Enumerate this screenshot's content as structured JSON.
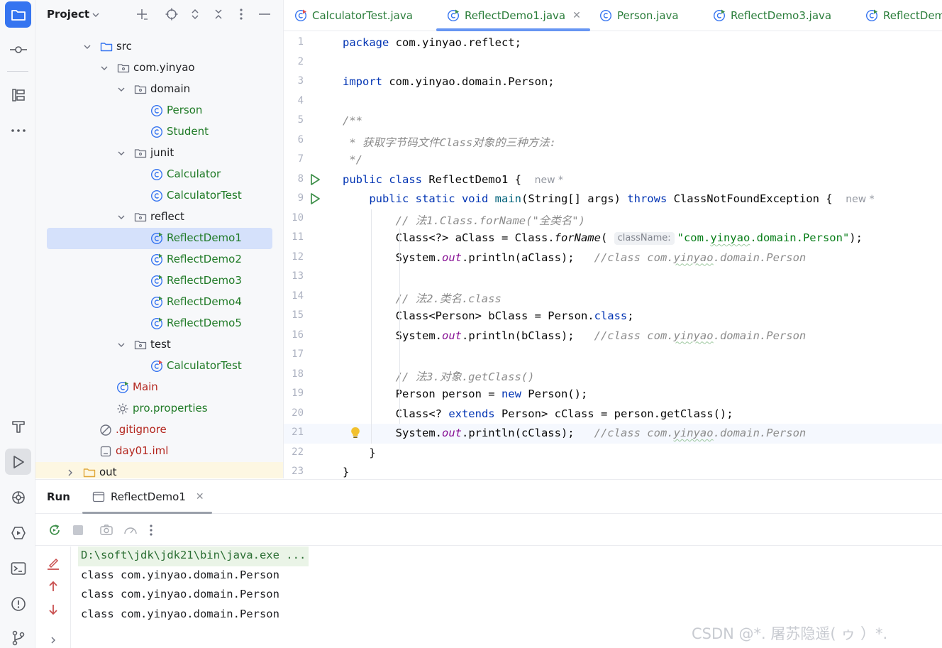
{
  "project_panel": {
    "title": "Project",
    "tree": [
      {
        "label": "src",
        "kind": "folder",
        "depth": 0,
        "expanded": true
      },
      {
        "label": "com.yinyao",
        "kind": "package",
        "depth": 1,
        "expanded": true
      },
      {
        "label": "domain",
        "kind": "package",
        "depth": 2,
        "expanded": true
      },
      {
        "label": "Person",
        "kind": "class",
        "depth": 3
      },
      {
        "label": "Student",
        "kind": "class",
        "depth": 3
      },
      {
        "label": "junit",
        "kind": "package",
        "depth": 2,
        "expanded": true
      },
      {
        "label": "Calculator",
        "kind": "class",
        "depth": 3
      },
      {
        "label": "CalculatorTest",
        "kind": "class",
        "depth": 3
      },
      {
        "label": "reflect",
        "kind": "package",
        "depth": 2,
        "expanded": true
      },
      {
        "label": "ReflectDemo1",
        "kind": "main-class",
        "depth": 3,
        "selected": true
      },
      {
        "label": "ReflectDemo2",
        "kind": "main-class",
        "depth": 3
      },
      {
        "label": "ReflectDemo3",
        "kind": "main-class",
        "depth": 3
      },
      {
        "label": "ReflectDemo4",
        "kind": "main-class",
        "depth": 3
      },
      {
        "label": "ReflectDemo5",
        "kind": "main-class",
        "depth": 3
      },
      {
        "label": "test",
        "kind": "package",
        "depth": 2,
        "expanded": true
      },
      {
        "label": "CalculatorTest",
        "kind": "test-class",
        "depth": 3
      },
      {
        "label": "Main",
        "kind": "main-class-red",
        "depth": 1
      },
      {
        "label": "pro.properties",
        "kind": "properties",
        "depth": 1
      },
      {
        "label": ".gitignore",
        "kind": "ignore",
        "depth": 0
      },
      {
        "label": "day01.iml",
        "kind": "iml",
        "depth": 0
      },
      {
        "label": "out",
        "kind": "out-folder",
        "depth": -1
      }
    ]
  },
  "tabs": [
    {
      "label": "CalculatorTest.java",
      "active": false
    },
    {
      "label": "ReflectDemo1.java",
      "active": true
    },
    {
      "label": "Person.java",
      "active": false
    },
    {
      "label": "ReflectDemo3.java",
      "active": false
    },
    {
      "label": "ReflectDem",
      "active": false
    }
  ],
  "editor": {
    "current_line": 21,
    "lines": [
      {
        "n": "1",
        "html": "<span class=\"kw\">package</span> com.yinyao.reflect;"
      },
      {
        "n": "2",
        "html": ""
      },
      {
        "n": "3",
        "html": "<span class=\"kw\">import</span> com.yinyao.domain.Person;"
      },
      {
        "n": "4",
        "html": ""
      },
      {
        "n": "5",
        "html": "<span class=\"cm\">/**</span>"
      },
      {
        "n": "6",
        "html": "<span class=\"cm\"> * 获取字节码文件Class对象的三种方法:</span>"
      },
      {
        "n": "7",
        "html": "<span class=\"cm\"> */</span>"
      },
      {
        "n": "8",
        "html": "<span class=\"kw\">public class</span> ReflectDemo1 {  <span class=\"newhint\">new *</span>",
        "run": true
      },
      {
        "n": "9",
        "html": "    <span class=\"kw\">public static void</span> <span class=\"mth\">main</span>(String[] args) <span class=\"kw\">throws</span> ClassNotFoundException {  <span class=\"newhint\">new *</span>",
        "run": true
      },
      {
        "n": "10",
        "html": "        <span class=\"cm\">// 法1.Class.forName(\"全类名\")</span>"
      },
      {
        "n": "11",
        "html": "        Class&lt;?&gt; aClass = Class.<span class=\"ital\">forName</span>( <span class=\"hint\">className:</span><span class=\"str\">\"com.<span class=\"wavy\">yinyao</span>.domain.Person\"</span>);"
      },
      {
        "n": "12",
        "html": "        System.<span class=\"fld\">out</span>.println(aClass);   <span class=\"cm\">//class com.<span class=\"wavy\">yinyao</span>.domain.Person</span>"
      },
      {
        "n": "13",
        "html": ""
      },
      {
        "n": "14",
        "html": "        <span class=\"cm\">// 法2.类名.class</span>"
      },
      {
        "n": "15",
        "html": "        Class&lt;Person&gt; bClass = Person.<span class=\"kw\">class</span>;"
      },
      {
        "n": "16",
        "html": "        System.<span class=\"fld\">out</span>.println(bClass);   <span class=\"cm\">//class com.<span class=\"wavy\">yinyao</span>.domain.Person</span>"
      },
      {
        "n": "17",
        "html": ""
      },
      {
        "n": "18",
        "html": "        <span class=\"cm\">// 法3.对象.getClass()</span>"
      },
      {
        "n": "19",
        "html": "        Person person = <span class=\"kw\">new</span> Person();"
      },
      {
        "n": "20",
        "html": "        Class&lt;? <span class=\"kw\">extends</span> Person&gt; cClass = person.getClass();"
      },
      {
        "n": "21",
        "html": "        System.<span class=\"fld\">out</span>.println(cClass);   <span class=\"cm\">//class com.<span class=\"wavy\">yinyao</span>.domain.Person</span>",
        "bulb": true
      },
      {
        "n": "22",
        "html": "    }"
      },
      {
        "n": "23",
        "html": "}"
      }
    ]
  },
  "run_panel": {
    "title": "Run",
    "tab_label": "ReflectDemo1",
    "console": [
      "D:\\soft\\jdk\\jdk21\\bin\\java.exe ...",
      "class com.yinyao.domain.Person",
      "class com.yinyao.domain.Person",
      "class com.yinyao.domain.Person"
    ]
  },
  "watermark": "CSDN @*. 屠苏隐遥(  ゥ ）*.",
  "icons": {
    "toolstrip_top": [
      "project-icon",
      "commit-icon",
      "structure-icon",
      "more-icon"
    ],
    "toolstrip_bottom": [
      "build-icon",
      "run-icon",
      "services-icon",
      "debug-icon",
      "terminal-icon",
      "problems-icon",
      "git-icon"
    ]
  },
  "colors": {
    "accent": "#3574f0",
    "class_green": "#1f7a26",
    "ignored_red": "#b3261e",
    "keyword": "#0033b3",
    "string": "#067d17"
  }
}
